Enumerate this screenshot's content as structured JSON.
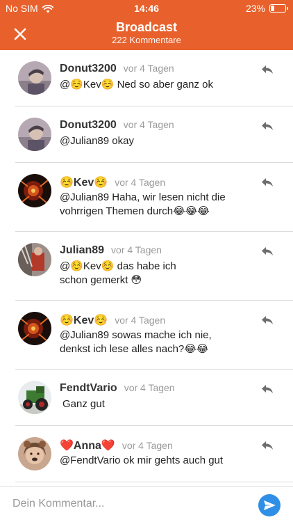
{
  "status_bar": {
    "carrier": "No SIM",
    "time": "14:46",
    "battery": "23%",
    "battery_level": 0.23,
    "wifi_icon": "wifi-icon"
  },
  "nav": {
    "title": "Broadcast",
    "subtitle": "222 Kommentare",
    "close_icon": "close-icon"
  },
  "colors": {
    "header_bg": "#e8612c",
    "send_button": "#2f8fe6",
    "time_text": "#9a9a9a"
  },
  "comments": [
    {
      "author": "Donut3200",
      "time": "vor 4 Tagen",
      "text": "@☺️Kev☺️ Ned so aber ganz ok"
    },
    {
      "author": "Donut3200",
      "time": "vor 4 Tagen",
      "text": "@Julian89 okay"
    },
    {
      "author": "☺️Kev☺️",
      "time": "vor 4 Tagen",
      "text": "@Julian89 Haha, wir lesen nicht die vohrrigen Themen durch😂😂😂"
    },
    {
      "author": "Julian89",
      "time": "vor 4 Tagen",
      "text": "@☺️Kev☺️ das habe ich schon gemerkt 😳"
    },
    {
      "author": "☺️Kev☺️",
      "time": "vor 4 Tagen",
      "text": "@Julian89 sowas mache ich nie, denkst ich lese alles nach?😂😂"
    },
    {
      "author": "FendtVario",
      "time": "vor 4 Tagen",
      "text": "Ganz gut"
    },
    {
      "author": "❤️Anna❤️",
      "time": "vor 4 Tagen",
      "text": "@FendtVario ok mir gehts auch gut"
    }
  ],
  "input": {
    "placeholder": "Dein Kommentar...",
    "value": "",
    "send_icon": "send-icon"
  }
}
